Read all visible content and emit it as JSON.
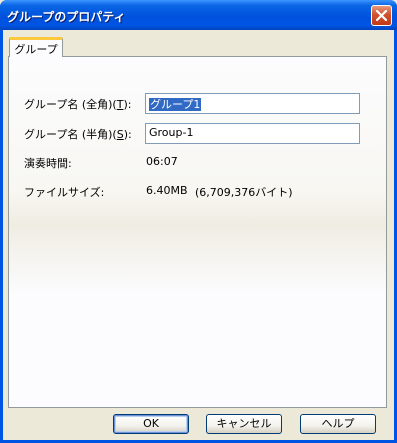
{
  "window": {
    "title": "グループのプロパティ"
  },
  "tabs": [
    {
      "label": "グループ"
    }
  ],
  "form": {
    "name_full_label": "グループ名 (全角)(",
    "name_full_key": "T",
    "name_full_tail": "):",
    "name_full_value": "グループ1",
    "name_half_label": "グループ名 (半角)(",
    "name_half_key": "S",
    "name_half_tail": "):",
    "name_half_value": "Group-1",
    "duration_label": "演奏時間:",
    "duration_value": "06:07",
    "filesize_label": "ファイルサイズ:",
    "filesize_value": "6.40MB",
    "filesize_bytes": "(6,709,376バイト)"
  },
  "buttons": {
    "ok": "OK",
    "cancel": "キャンセル",
    "help": "ヘルプ"
  },
  "colors": {
    "titlebar": "#0054E3",
    "tab_highlight": "#FFC83C",
    "selection": "#316AC5",
    "close_button": "#D4502C"
  },
  "icons": {
    "close": "close-icon"
  }
}
